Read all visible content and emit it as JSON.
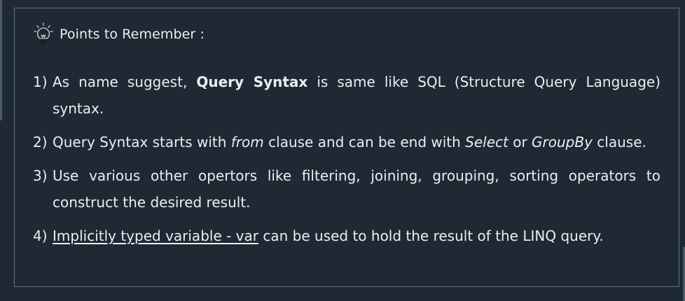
{
  "note": {
    "icon": "lightbulb-icon",
    "title": "Points to Remember :",
    "points": [
      {
        "number": "1)",
        "before": "As name suggest, ",
        "bold": "Query Syntax",
        "after": " is same like SQL (Structure Query Language) syntax."
      },
      {
        "number": "2)",
        "text1": "Query Syntax starts with ",
        "italic1": "from",
        "text2": " clause and can be end with ",
        "italic2": "Select",
        "text3": " or ",
        "italic3": "GroupBy",
        "text4": " clause."
      },
      {
        "number": "3)",
        "text": "Use various other opertors like filtering, joining, grouping, sorting operators to construct the desired result."
      },
      {
        "number": "4)",
        "link": "Implicitly typed variable - var",
        "after": " can be used to hold the result of the LINQ query."
      }
    ]
  },
  "colors": {
    "background": "#1e2933",
    "border": "#667482",
    "text": "#e9eef3"
  }
}
